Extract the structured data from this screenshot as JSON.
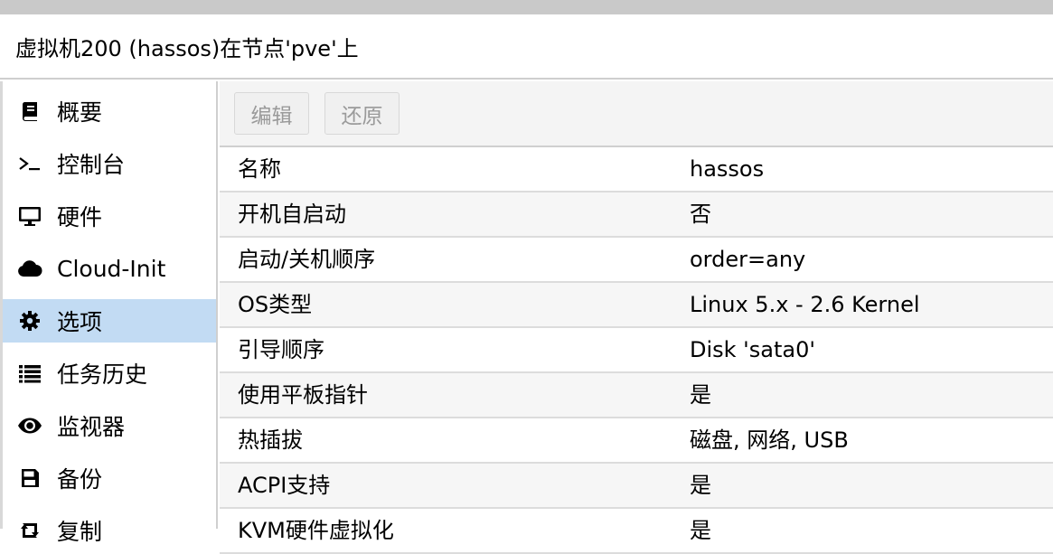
{
  "window": {
    "title": "虚拟机200 (hassos)在节点'pve'上"
  },
  "sidebar": {
    "items": [
      {
        "label": "概要",
        "icon": "book-icon"
      },
      {
        "label": "控制台",
        "icon": "terminal-icon"
      },
      {
        "label": "硬件",
        "icon": "monitor-icon"
      },
      {
        "label": "Cloud-Init",
        "icon": "cloud-icon"
      },
      {
        "label": "选项",
        "icon": "gear-icon",
        "active": true
      },
      {
        "label": "任务历史",
        "icon": "list-icon"
      },
      {
        "label": "监视器",
        "icon": "eye-icon"
      },
      {
        "label": "备份",
        "icon": "floppy-icon"
      },
      {
        "label": "复制",
        "icon": "retweet-icon"
      }
    ]
  },
  "toolbar": {
    "edit_label": "编辑",
    "revert_label": "还原"
  },
  "options": [
    {
      "name": "名称",
      "value": "hassos"
    },
    {
      "name": "开机自启动",
      "value": "否"
    },
    {
      "name": "启动/关机顺序",
      "value": "order=any"
    },
    {
      "name": "OS类型",
      "value": "Linux 5.x - 2.6 Kernel"
    },
    {
      "name": "引导顺序",
      "value": "Disk 'sata0'"
    },
    {
      "name": "使用平板指针",
      "value": "是"
    },
    {
      "name": "热插拔",
      "value": "磁盘, 网络, USB"
    },
    {
      "name": "ACPI支持",
      "value": "是"
    },
    {
      "name": "KVM硬件虚拟化",
      "value": "是"
    }
  ],
  "colors": {
    "selected": "#c2dbf3",
    "border": "#cfcfcf"
  }
}
